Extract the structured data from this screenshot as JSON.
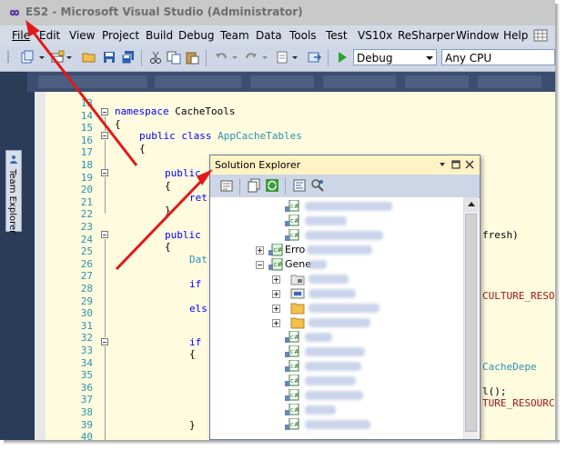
{
  "window": {
    "title": "ES2 - Microsoft Visual Studio (Administrator)"
  },
  "menu": [
    {
      "label": "File",
      "key": "F"
    },
    {
      "label": "Edit",
      "key": "E"
    },
    {
      "label": "View",
      "key": "V"
    },
    {
      "label": "Project",
      "key": "P"
    },
    {
      "label": "Build",
      "key": "B"
    },
    {
      "label": "Debug",
      "key": "D"
    },
    {
      "label": "Team",
      "key": "m"
    },
    {
      "label": "Data",
      "key": "a"
    },
    {
      "label": "Tools",
      "key": "T"
    },
    {
      "label": "Test",
      "key": "s"
    },
    {
      "label": "VS10x",
      "key": ""
    },
    {
      "label": "ReSharper",
      "key": "R"
    },
    {
      "label": "Window",
      "key": "W"
    },
    {
      "label": "Help",
      "key": "H"
    }
  ],
  "toolbar": {
    "configuration": "Debug",
    "platform": "Any CPU"
  },
  "side_panel": {
    "team_explorer_label": "Team Explorer"
  },
  "editor": {
    "line_numbers": [
      "13",
      "14",
      "15",
      "16",
      "17",
      "18",
      "19",
      "20",
      "21",
      "22",
      "23",
      "24",
      "25",
      "26",
      "27",
      "28",
      "29",
      "30",
      "31",
      "32",
      "33",
      "34",
      "35",
      "36",
      "37",
      "38",
      "39",
      "40"
    ],
    "lines": {
      "l14_kw": "namespace",
      "l14_rest": " CacheTools",
      "l15": "{",
      "l16_kw1": "public",
      "l16_kw2": "class",
      "l16_type": "AppCacheTables",
      "l17": "{",
      "l19_kw": "public",
      "l20": "{",
      "l21_kw": "ret",
      "l22": "}",
      "l24_kw": "public",
      "l24_tail": "fresh)",
      "l25": "{",
      "l26_type": "Dat",
      "l28_kw": "if",
      "l28_tail": "CULTURE_RESOU",
      "l30_kw": "els",
      "l33_kw": "if",
      "l34": "{",
      "l35_tail": "CacheDepe",
      "l37_tail": "l();",
      "l38_tail": "TURE_RESOURC",
      "l40": "}"
    }
  },
  "solution_explorer": {
    "title": "Solution Explorer",
    "visible_labels": {
      "errors_node": "Erro",
      "general_node": "Gene"
    }
  },
  "colors": {
    "keyword": "#0000ff",
    "type": "#2b91af",
    "string": "#a31515",
    "editor_bg": "#fffbdf",
    "annotation_arrow": "#e01a1a"
  }
}
